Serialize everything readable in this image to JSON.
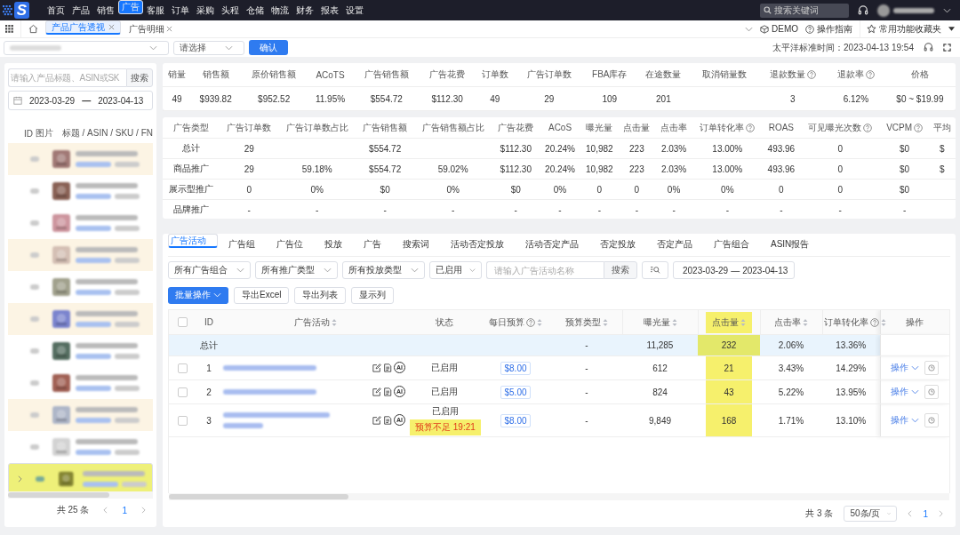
{
  "nav": {
    "logo": "S",
    "items": [
      {
        "label": "首页",
        "selected": false
      },
      {
        "label": "产品",
        "selected": false
      },
      {
        "label": "销售",
        "selected": false
      },
      {
        "label": "广告",
        "selected": true
      },
      {
        "label": "客服",
        "selected": false
      },
      {
        "label": "订单",
        "selected": false
      },
      {
        "label": "采购",
        "selected": false
      },
      {
        "label": "头程",
        "selected": false
      },
      {
        "label": "仓储",
        "selected": false
      },
      {
        "label": "物流",
        "selected": false
      },
      {
        "label": "财务",
        "selected": false
      },
      {
        "label": "报表",
        "selected": false
      },
      {
        "label": "设置",
        "selected": false
      }
    ],
    "search_placeholder": "搜索关键词"
  },
  "page_tabs": [
    {
      "label": "产品广告透视",
      "selected": true
    },
    {
      "label": "广告明细",
      "selected": false
    }
  ],
  "toolbar_links": [
    {
      "kind": "cube",
      "label": "DEMO"
    },
    {
      "kind": "help",
      "label": "操作指南"
    },
    {
      "kind": "star",
      "label": "常用功能收藏夹"
    }
  ],
  "filter_bar": {
    "select_placeholder": "请选择",
    "confirm": "确认",
    "timezone_time": "太平洋标准时间：2023-04-13 19:54"
  },
  "products": {
    "search_placeholder": "请输入产品标题、ASIN或SK",
    "search_button": "搜索",
    "date_start": "2023-03-29",
    "date_sep": "—",
    "date_end": "2023-04-13",
    "columns": [
      "ID",
      "图片",
      "标题 / ASIN / SKU / FN"
    ],
    "rows": [
      {
        "tinted": true,
        "selected": false
      },
      {
        "tinted": false,
        "selected": false
      },
      {
        "tinted": false,
        "selected": false
      },
      {
        "tinted": true,
        "selected": false
      },
      {
        "tinted": false,
        "selected": false
      },
      {
        "tinted": true,
        "selected": false
      },
      {
        "tinted": false,
        "selected": false
      },
      {
        "tinted": false,
        "selected": false
      },
      {
        "tinted": true,
        "selected": false
      },
      {
        "tinted": false,
        "selected": false
      },
      {
        "tinted": false,
        "selected": true
      }
    ],
    "total": "共 25 条",
    "page": "1"
  },
  "summary": {
    "columns": [
      {
        "label": "销量",
        "help": false,
        "value": "49"
      },
      {
        "label": "销售额",
        "help": false,
        "value": "$939.82"
      },
      {
        "label": "原价销售额",
        "help": false,
        "value": "$952.52"
      },
      {
        "label": "ACoTS",
        "help": false,
        "value": "11.95%"
      },
      {
        "label": "广告销售额",
        "help": false,
        "value": "$554.72"
      },
      {
        "label": "广告花费",
        "help": false,
        "value": "$112.30"
      },
      {
        "label": "订单数",
        "help": false,
        "value": "49"
      },
      {
        "label": "广告订单数",
        "help": false,
        "value": "29"
      },
      {
        "label": "FBA库存",
        "help": false,
        "value": "109"
      },
      {
        "label": "在途数量",
        "help": false,
        "value": "201"
      },
      {
        "label": "取消销量数",
        "help": false
      },
      {
        "label": "退款数量",
        "help": true,
        "value": "3"
      },
      {
        "label": "退款率",
        "help": true,
        "value": "6.12%"
      },
      {
        "label": "价格",
        "help": false,
        "value": "$0 ~ $19.99"
      }
    ]
  },
  "ad_types": {
    "columns": [
      {
        "label": "广告类型",
        "help": false
      },
      {
        "label": "广告订单数",
        "help": false
      },
      {
        "label": "广告订单数占比",
        "help": false
      },
      {
        "label": "广告销售额",
        "help": false
      },
      {
        "label": "广告销售额占比",
        "help": false
      },
      {
        "label": "广告花费",
        "help": false
      },
      {
        "label": "ACoS",
        "help": false
      },
      {
        "label": "曝光量",
        "help": false
      },
      {
        "label": "点击量",
        "help": false
      },
      {
        "label": "点击率",
        "help": false
      },
      {
        "label": "订单转化率",
        "help": true
      },
      {
        "label": "ROAS",
        "help": false
      },
      {
        "label": "可见曝光次数",
        "help": true
      },
      {
        "label": "VCPM",
        "help": true
      },
      {
        "label": "平均",
        "help": false
      }
    ],
    "rows": [
      [
        "总计",
        "29",
        null,
        "$554.72",
        null,
        "$112.30",
        "20.24%",
        "10,982",
        "223",
        "2.03%",
        "13.00%",
        "493.96",
        "0",
        "$0",
        "$"
      ],
      [
        "商品推广",
        "29",
        "59.18%",
        "$554.72",
        "59.02%",
        "$112.30",
        "20.24%",
        "10,982",
        "223",
        "2.03%",
        "13.00%",
        "493.96",
        "0",
        "$0",
        "$"
      ],
      [
        "展示型推广",
        "0",
        "0%",
        "$0",
        "0%",
        "$0",
        "0%",
        "0",
        "0",
        "0%",
        "0%",
        "0",
        "0",
        "$0",
        null
      ],
      [
        "品牌推广",
        "-",
        "-",
        "-",
        "-",
        "-",
        "-",
        "-",
        "-",
        "-",
        "-",
        "-",
        "-",
        "-",
        null
      ]
    ]
  },
  "report_tabs": [
    {
      "label": "广告活动",
      "selected": true
    },
    {
      "label": "广告组",
      "selected": false
    },
    {
      "label": "广告位",
      "selected": false
    },
    {
      "label": "投放",
      "selected": false
    },
    {
      "label": "广告",
      "selected": false
    },
    {
      "label": "搜索词",
      "selected": false
    },
    {
      "label": "活动否定投放",
      "selected": false
    },
    {
      "label": "活动否定产品",
      "selected": false
    },
    {
      "label": "否定投放",
      "selected": false
    },
    {
      "label": "否定产品",
      "selected": false
    },
    {
      "label": "广告组合",
      "selected": false
    },
    {
      "label": "ASIN报告",
      "selected": false
    }
  ],
  "campaign_filters": {
    "selects": [
      "所有广告组合",
      "所有推广类型",
      "所有投放类型",
      "已启用"
    ],
    "search_placeholder": "请输入广告活动名称",
    "search_button": "搜索",
    "date_start": "2023-03-29",
    "date_sep": "—",
    "date_end": "2023-04-13"
  },
  "actions": [
    {
      "label": "批量操作",
      "primary": true
    },
    {
      "label": "导出Excel",
      "primary": false
    },
    {
      "label": "导出列表",
      "primary": false
    },
    {
      "label": "显示列",
      "primary": false
    }
  ],
  "campaigns": {
    "header_checked": false,
    "columns": [
      {
        "label": "ID",
        "sortable": false,
        "help": false,
        "highlighted": false
      },
      {
        "label": "广告活动",
        "sortable": true,
        "help": false,
        "highlighted": false
      },
      {
        "label": "状态",
        "sortable": false,
        "help": false,
        "highlighted": false
      },
      {
        "label": "每日预算",
        "sortable": true,
        "help": true,
        "highlighted": false
      },
      {
        "label": "预算类型",
        "sortable": true,
        "help": false,
        "highlighted": false
      },
      {
        "label": "曝光量",
        "sortable": true,
        "help": false,
        "highlighted": false
      },
      {
        "label": "点击量",
        "sortable": true,
        "help": false,
        "highlighted": true
      },
      {
        "label": "点击率",
        "sortable": true,
        "help": false,
        "highlighted": false
      },
      {
        "label": "订单转化率",
        "sortable": true,
        "help": true,
        "highlighted": false
      },
      {
        "label": "操作",
        "sortable": false,
        "help": false,
        "highlighted": false
      }
    ],
    "total": {
      "label": "总计",
      "budget_type": "-",
      "impressions": "11,285",
      "clicks": "232",
      "ctr": "2.06%",
      "cvr": "13.36%"
    },
    "rows": [
      {
        "checked": false,
        "id": "1",
        "badge": "AI",
        "status": "已启用",
        "budget": "$8.00",
        "budget_type": "-",
        "impressions": "612",
        "clicks": "21",
        "ctr": "3.43%",
        "cvr": "14.29%",
        "action": "操作"
      },
      {
        "checked": false,
        "id": "2",
        "badge": "AI",
        "status": "已启用",
        "budget": "$5.00",
        "budget_type": "-",
        "impressions": "824",
        "clicks": "43",
        "ctr": "5.22%",
        "cvr": "13.95%",
        "action": "操作"
      },
      {
        "checked": false,
        "id": "3",
        "badge": "AI",
        "status": "已启用",
        "warning": "预算不足 19:21",
        "budget": "$8.00",
        "budget_type": "-",
        "impressions": "9,849",
        "clicks": "168",
        "ctr": "1.71%",
        "cvr": "13.10%",
        "action": "操作"
      }
    ],
    "total_count": "共 3 条",
    "page_size": "50条/页",
    "page": "1"
  }
}
